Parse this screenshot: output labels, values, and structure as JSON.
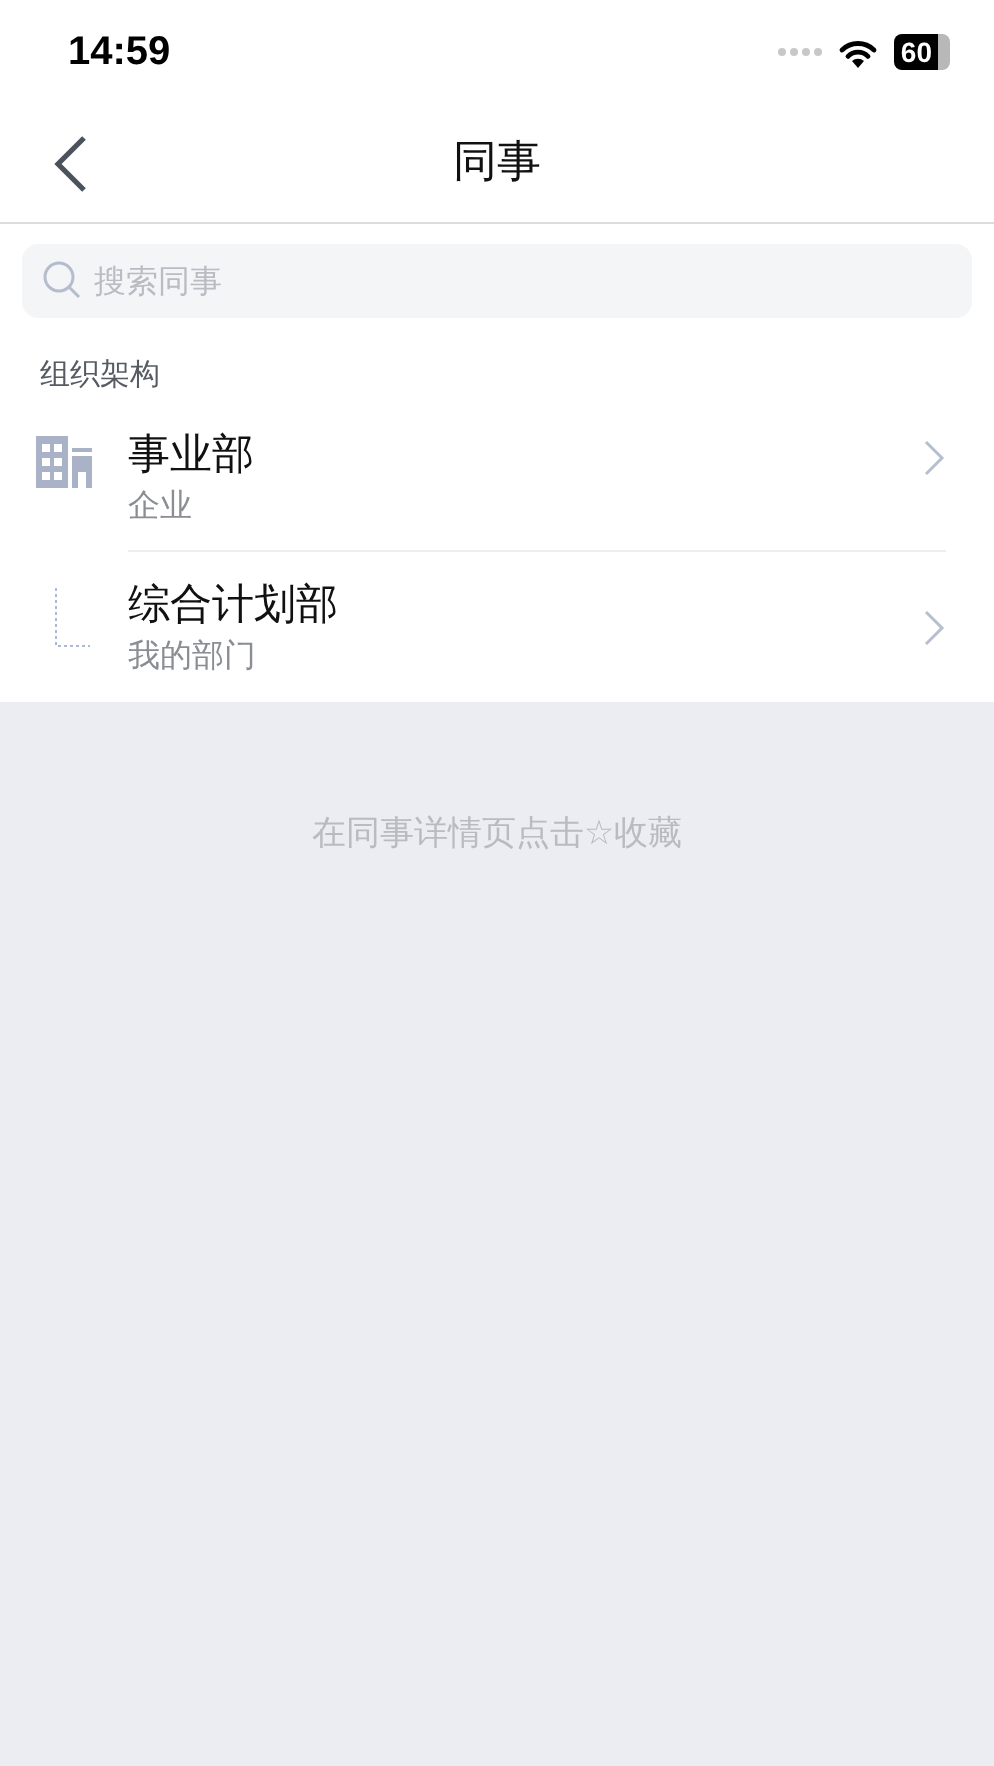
{
  "status_bar": {
    "time": "14:59",
    "battery": "60"
  },
  "nav": {
    "title": "同事"
  },
  "search": {
    "placeholder": "搜索同事"
  },
  "section": {
    "title": "组织架构"
  },
  "org": [
    {
      "name": "事业部",
      "subtitle": "企业",
      "children": [
        {
          "name": "综合计划部",
          "subtitle": "我的部门"
        }
      ]
    }
  ],
  "empty_hint": "在同事详情页点击☆收藏"
}
